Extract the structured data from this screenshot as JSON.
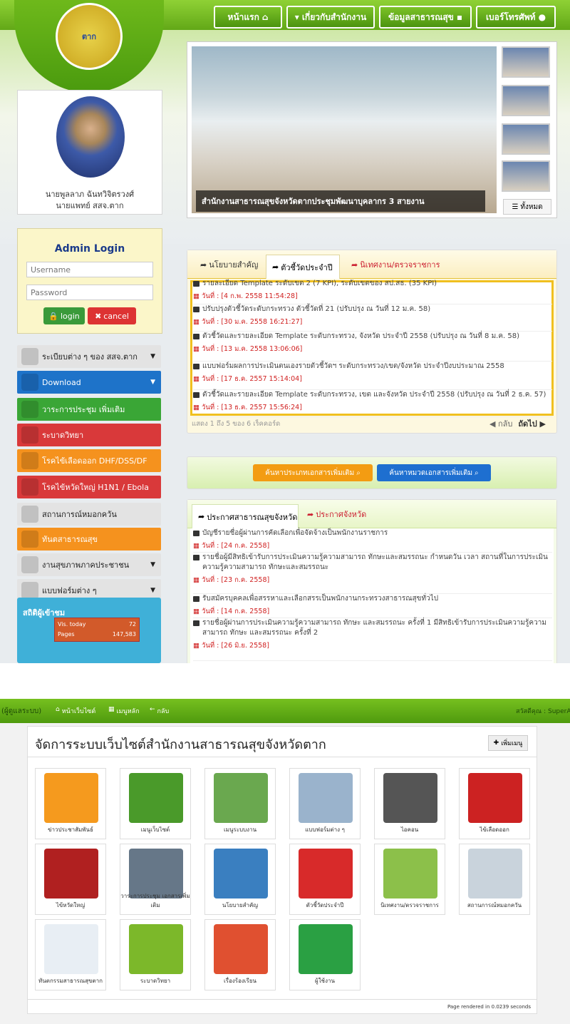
{
  "nav": {
    "home": "หน้าแรก",
    "about": "เกี่ยวกับสำนักงาน",
    "health_info": "ข้อมูลสาธารณสุข",
    "phone": "เบอร์โทรศัพท์"
  },
  "profile": {
    "name": "นายพูลลาภ ฉันทวิจิตรวงศ์",
    "title": "นายแพทย์ สสจ.ตาก"
  },
  "login": {
    "title": "Admin Login",
    "username_ph": "Username",
    "password_ph": "Password",
    "login": "login",
    "cancel": "cancel"
  },
  "menu": [
    {
      "label": "ระเบียบต่าง ๆ ของ สสจ.ตาก",
      "color": "#e3e3e3",
      "text": "#222",
      "caret": true
    },
    {
      "label": "Download",
      "color": "#1e73c9",
      "text": "#fff",
      "caret": true
    },
    {
      "label": "วาระการประชุม เพิ่มเติม",
      "color": "#3aa636",
      "text": "#fff",
      "caret": false
    },
    {
      "label": "ระบาดวิทยา",
      "color": "#d9393a",
      "text": "#fff",
      "caret": false
    },
    {
      "label": "โรคไข้เลือดออก DHF/DSS/DF",
      "color": "#f5921e",
      "text": "#fff",
      "caret": false
    },
    {
      "label": "โรคไข้หวัดใหญ่ H1N1 / Ebola",
      "color": "#d9393a",
      "text": "#fff",
      "caret": false
    },
    {
      "label": "สถานการณ์หมอกควัน",
      "color": "#e3e3e3",
      "text": "#222",
      "caret": false
    },
    {
      "label": "ทันตสาธารณสุข",
      "color": "#f5921e",
      "text": "#fff",
      "caret": false
    },
    {
      "label": "งานสุขภาพภาคประชาชน",
      "color": "#e3e3e3",
      "text": "#222",
      "caret": true
    },
    {
      "label": "แบบฟอร์มต่าง ๆ",
      "color": "#e3e3e3",
      "text": "#222",
      "caret": true
    }
  ],
  "stats": {
    "title": "สถิติผู้เข้าชม",
    "today_label": "Vis. today",
    "today": "72",
    "pages_label": "Pages",
    "pages": "147,583"
  },
  "slider": {
    "caption": "สำนักงานสาธารณสุขจังหวัดตากประชุมพัฒนาบุคลากร 3 สายงาน",
    "all": "ทั้งหมด"
  },
  "kpi": {
    "tabs": [
      "นโยบายสำคัญ",
      "ตัวชี้วัดประจำปี",
      "นิเทศงาน/ตรวจราชการ"
    ],
    "rows": [
      {
        "text": "รายละเอียด Template ระดับเขต 2 (7 KPI), ระดับเขตของ สป.สธ. (35 KPI)",
        "date": "วันที่ : [4 ก.พ. 2558 11:54:28]"
      },
      {
        "text": "ปรับปรุงตัวชี้วัดระดับกระทรวง ตัวชี้วัดที่ 21 (ปรับปรุง ณ วันที่ 12 ม.ค. 58)",
        "date": "วันที่ : [30 ม.ค. 2558 16:21:27]"
      },
      {
        "text": "ตัวชี้วัดและรายละเอียด Template ระดับกระทรวง, จังหวัด ประจำปี 2558 (ปรับปรุง ณ วันที่ 8 ม.ค. 58)",
        "date": "วันที่ : [13 ม.ค. 2558 13:06:06]"
      },
      {
        "text": "แบบฟอร์มผลการประเมินตนเองรายตัวชี้วัดฯ ระดับกระทรวง/เขต/จังหวัด ประจำปีงบประมาณ 2558",
        "date": "วันที่ : [17 ธ.ค. 2557 15:14:04]"
      },
      {
        "text": "ตัวชี้วัดและรายละเอียด Template ระดับกระทรวง, เขต และจังหวัด ประจำปี 2558 (ปรับปรุง ณ วันที่ 2 ธ.ค. 57)",
        "date": "วันที่ : [13 ธ.ค. 2557 15:56:24]"
      }
    ],
    "footer": "แสดง 1 ถึง 5 ของ 6 เร็คคอร์ด",
    "prev": "กลับ",
    "next": "ถัดไป"
  },
  "search": {
    "btn1": "ค้นหาประเภทเอกสารเพิ่มเติม",
    "btn2": "ค้นหาหมวดเอกสารเพิ่มเติม"
  },
  "announce": {
    "tabs": [
      "ประกาศสาธารณสุขจังหวัด",
      "ประกาศจังหวัด"
    ],
    "rows": [
      {
        "text": "บัญชีรายชื่อผู้ผ่านการคัดเลือกเพื่อจัดจ้างเป็นพนักงานราชการ",
        "date": "วันที่ : [24 ก.ค. 2558]"
      },
      {
        "text": "รายชื่อผู้มีสิทธิเข้ารับการประเมินความรู้ความสามารถ ทักษะและสมรรถนะ กำหนดวัน เวลา สถานที่ในการประเมินความรู้ความสามารถ ทักษะและสมรรถนะ",
        "date": "วันที่ : [23 ก.ค. 2558]"
      },
      {
        "text": "รับสมัครบุคคลเพื่อสรรหาและเลือกสรรเป็นพนักงานกระทรวงสาธารณสุขทั่วไป",
        "date": "วันที่ : [14 ก.ค. 2558]"
      },
      {
        "text": "รายชื่อผู้ผ่านการประเมินความรู้ความสามารถ ทักษะ และสมรรถนะ ครั้งที่ 1 มีสิทธิเข้ารับการประเมินความรู้ความสามารถ ทักษะ และสมรรถนะ ครั้งที่ 2",
        "date": "วันที่ : [26 มิ.ย. 2558]"
      }
    ]
  },
  "admin": {
    "left": "(ผู้ดูแลระบบ)",
    "home": "หน้าเว็บไซต์",
    "menu": "เมนูหลัก",
    "back": "กลับ",
    "greeting": "สวัสดีคุณ : SuperAd",
    "title": "จัดการระบบเว็บไซต์สำนักงานสาธารณสุขจังหวัดตาก",
    "add": "เพิ่มเมนู",
    "tiles": [
      {
        "label": "ข่าวประชาสัมพันธ์",
        "color": "#f59a1e"
      },
      {
        "label": "เมนูเว็บไซต์",
        "color": "#4a9a2a"
      },
      {
        "label": "เมนูระบบงาน",
        "color": "#6aa84f"
      },
      {
        "label": "แบบฟอร์มต่าง ๆ",
        "color": "#9ab3cc"
      },
      {
        "label": "ไอคอน",
        "color": "#555555"
      },
      {
        "label": "ไข้เลือดออก",
        "color": "#cc2222"
      },
      {
        "label": "ไข้หวัดใหญ่",
        "color": "#b02020"
      },
      {
        "label": "วาระการประชุม เอกสารเพิ่มเติม",
        "color": "#667788"
      },
      {
        "label": "นโยบายสำคัญ",
        "color": "#3a7fc0"
      },
      {
        "label": "ตัวชี้วัดประจำปี",
        "color": "#d82a2a"
      },
      {
        "label": "นิเทศงาน/ตรวจราชการ",
        "color": "#8cc04a"
      },
      {
        "label": "สถานการณ์หมอกควัน",
        "color": "#c9d3dc"
      },
      {
        "label": "ทันตกรรมสาธารณสุขตาก",
        "color": "#e8eef4"
      },
      {
        "label": "ระบาดวิทยา",
        "color": "#7cb82a"
      },
      {
        "label": "เรื่องร้องเรียน",
        "color": "#e05030"
      },
      {
        "label": "ผู้ใช้งาน",
        "color": "#2aa043"
      }
    ],
    "footer": "Page rendered in 0.0239 seconds"
  }
}
